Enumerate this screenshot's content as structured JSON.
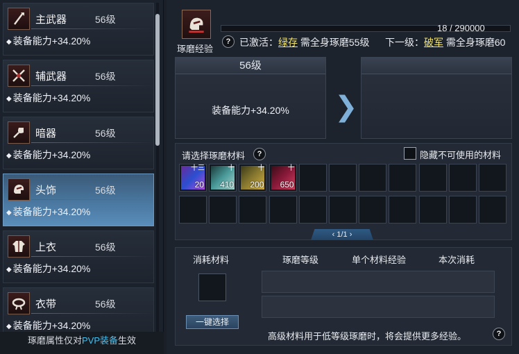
{
  "left_panel": {
    "items": [
      {
        "name": "主武器",
        "level": "56级",
        "stat": "装备能力+34.20%",
        "icon": "spear-icon",
        "selected": false
      },
      {
        "name": "辅武器",
        "level": "56级",
        "stat": "装备能力+34.20%",
        "icon": "crossed-blades-icon",
        "selected": false
      },
      {
        "name": "暗器",
        "level": "56级",
        "stat": "装备能力+34.20%",
        "icon": "dart-icon",
        "selected": false
      },
      {
        "name": "头饰",
        "level": "56级",
        "stat": "装备能力+34.20%",
        "icon": "helmet-icon",
        "selected": true
      },
      {
        "name": "上衣",
        "level": "56级",
        "stat": "装备能力+34.20%",
        "icon": "robe-icon",
        "selected": false
      },
      {
        "name": "衣带",
        "level": "56级",
        "stat": "装备能力+34.20%",
        "icon": "sash-icon",
        "selected": false
      }
    ],
    "note_prefix": "琢磨属性仅对",
    "note_highlight": "PVP装备",
    "note_suffix": "生效"
  },
  "header": {
    "icon_label": "琢磨经验",
    "exp_text": "18 / 290000",
    "exp_progress": 0.0001,
    "activated_label": "已激活：",
    "activated_name": "绿存",
    "activated_req": "需全身琢磨55级",
    "next_label": "下一级：",
    "next_name": "破军",
    "next_req": "需全身琢磨60"
  },
  "current": {
    "level": "56级",
    "stat": "装备能力+34.20%"
  },
  "next": {
    "level": "",
    "stat": ""
  },
  "materials": {
    "title": "请选择琢磨材料",
    "hide_label": "隐藏不可使用的材料",
    "hide_checked": false,
    "items": [
      {
        "count": "20",
        "tag": "十三"
      },
      {
        "count": "410",
        "tag": "十"
      },
      {
        "count": "200",
        "tag": "十"
      },
      {
        "count": "650",
        "tag": "十"
      }
    ],
    "page": "1/1"
  },
  "cost": {
    "col_material": "消耗材料",
    "col_level": "琢磨等级",
    "col_exp": "单个材料经验",
    "col_cost": "本次消耗",
    "one_key": "一键选择",
    "hint": "高级材料用于低等级琢磨时，将会提供更多经验。"
  },
  "colors": {
    "accent_blue": "#43c1f0",
    "highlight_yellow": "#f2e36a",
    "selected_row": "#4b7aa3"
  }
}
